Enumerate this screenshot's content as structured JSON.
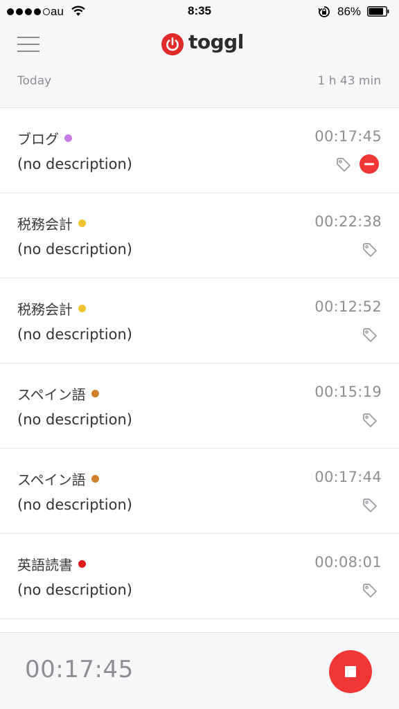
{
  "status_bar": {
    "carrier": "au",
    "time": "8:35",
    "battery": "86%",
    "battery_level": 0.86
  },
  "nav": {
    "brand": "toggl"
  },
  "day": {
    "label": "Today",
    "total": "1 h 43 min"
  },
  "entries": [
    {
      "project": "ブログ",
      "color": "#c77dea",
      "description": "(no description)",
      "duration": "00:17:45",
      "running": true
    },
    {
      "project": "税務会計",
      "color": "#f2c232",
      "description": "(no description)",
      "duration": "00:22:38",
      "running": false
    },
    {
      "project": "税務会計",
      "color": "#f2c232",
      "description": "(no description)",
      "duration": "00:12:52",
      "running": false
    },
    {
      "project": "スペイン語",
      "color": "#d0802a",
      "description": "(no description)",
      "duration": "00:15:19",
      "running": false
    },
    {
      "project": "スペイン語",
      "color": "#d0802a",
      "description": "(no description)",
      "duration": "00:17:44",
      "running": false
    },
    {
      "project": "英語読書",
      "color": "#e01b1b",
      "description": "(no description)",
      "duration": "00:08:01",
      "running": false
    }
  ],
  "timer": {
    "duration": "00:17:45"
  },
  "colors": {
    "accent": "#f03636",
    "logo": "#e12b2b"
  }
}
